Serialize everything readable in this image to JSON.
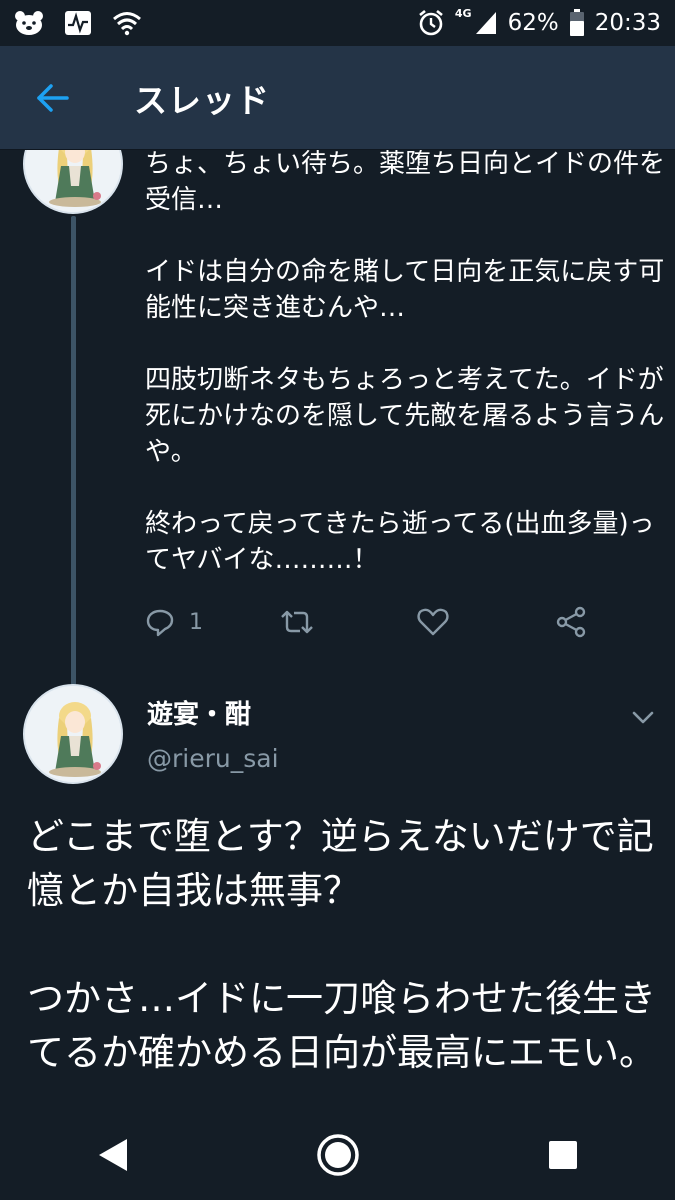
{
  "status_bar": {
    "network_type": "4G",
    "battery": "62%",
    "time": "20:33"
  },
  "header": {
    "title": "スレッド"
  },
  "tweet1": {
    "text": "ちょ、ちょい待ち。薬堕ち日向とイドの件を受信…\n\nイドは自分の命を賭して日向を正気に戻す可能性に突き進むんや…\n\n四肢切断ネタもちょろっと考えてた。イドが死にかけなのを隠して先敵を屠るよう言うんや。\n\n終わって戻ってきたら逝ってる(出血多量)ってヤバイな………！",
    "reply_count": "1"
  },
  "tweet2": {
    "author_name": "遊宴・酣",
    "author_handle": "@rieru_sai",
    "text": "どこまで堕とす？逆らえないだけで記憶とか自我は無事？\n\nつかさ…イドに一刀喰らわせた後生きてるか確かめる日向が最高にエモい。"
  },
  "colors": {
    "background": "#141d26",
    "header": "#243447",
    "accent": "#1da1f2",
    "muted": "#8899a6",
    "thread_line": "#3d5466"
  },
  "icons": {
    "back": "arrow-left-icon",
    "reply": "reply-icon",
    "retweet": "retweet-icon",
    "like": "heart-icon",
    "share": "share-icon",
    "more": "chevron-down-icon"
  }
}
